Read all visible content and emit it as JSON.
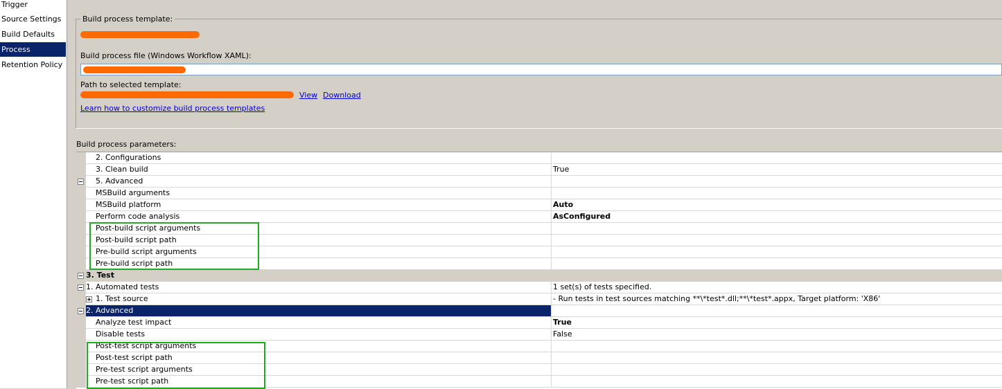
{
  "nav": {
    "items": [
      {
        "label": "Trigger",
        "selected": false
      },
      {
        "label": "Source Settings",
        "selected": false
      },
      {
        "label": "Build Defaults",
        "selected": false
      },
      {
        "label": "Process",
        "selected": true
      },
      {
        "label": "Retention Policy",
        "selected": false
      }
    ]
  },
  "template": {
    "group_label": "Build process template:",
    "file_label": "Build process file (Windows Workflow XAML):",
    "path_label": "Path to selected template:",
    "view_link": "View",
    "download_link": "Download",
    "learn_link": "Learn how to customize build process templates"
  },
  "parameters": {
    "label": "Build process parameters:",
    "rows": [
      {
        "name": "2. Configurations",
        "value": ""
      },
      {
        "name": "3. Clean build",
        "value": "True"
      },
      {
        "name": "5. Advanced",
        "value": ""
      },
      {
        "name": "MSBuild arguments",
        "value": ""
      },
      {
        "name": "MSBuild platform",
        "value": "Auto"
      },
      {
        "name": "Perform code analysis",
        "value": "AsConfigured"
      },
      {
        "name": "Post-build script arguments",
        "value": ""
      },
      {
        "name": "Post-build script path",
        "value": ""
      },
      {
        "name": "Pre-build script arguments",
        "value": ""
      },
      {
        "name": "Pre-build script path",
        "value": ""
      },
      {
        "name": "3. Test",
        "value": ""
      },
      {
        "name": "1. Automated tests",
        "value": "1 set(s) of tests specified."
      },
      {
        "name": "1. Test source",
        "value": " - Run tests in test sources matching **\\*test*.dll;**\\*test*.appx, Target platform: 'X86'"
      },
      {
        "name": "2. Advanced",
        "value": ""
      },
      {
        "name": "Analyze test impact",
        "value": "True"
      },
      {
        "name": "Disable tests",
        "value": "False"
      },
      {
        "name": "Post-test script arguments",
        "value": ""
      },
      {
        "name": "Post-test script path",
        "value": ""
      },
      {
        "name": "Pre-test script arguments",
        "value": ""
      },
      {
        "name": "Pre-test script path",
        "value": ""
      }
    ]
  },
  "colors": {
    "selection": "#0a246a",
    "highlight_box": "#22aa22",
    "redaction": "#ff6a00",
    "link": "#0000cc"
  }
}
